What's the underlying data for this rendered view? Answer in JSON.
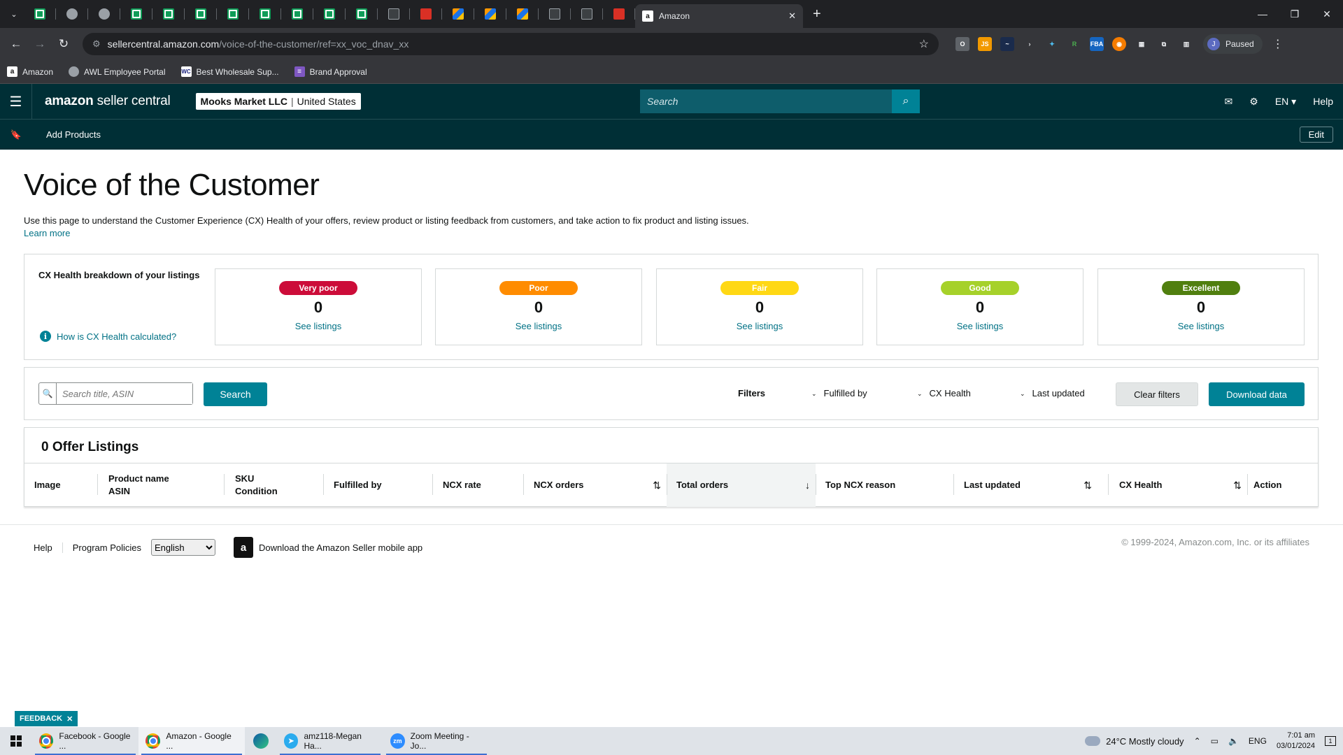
{
  "browser": {
    "active_tab_title": "Amazon",
    "url_domain": "sellercentral.amazon.com",
    "url_path": "/voice-of-the-customer/ref=xx_voc_dnav_xx",
    "profile_label": "Paused",
    "profile_initial": "J",
    "bookmarks": [
      {
        "label": "Amazon"
      },
      {
        "label": "AWL Employee Portal"
      },
      {
        "label": "Best Wholesale Sup..."
      },
      {
        "label": "Brand Approval"
      }
    ]
  },
  "header": {
    "logo_text": "amazon",
    "logo_suffix": " seller central",
    "business_name": "Mooks Market LLC",
    "marketplace": "United States",
    "search_placeholder": "Search",
    "language": "EN",
    "help": "Help"
  },
  "subnav": {
    "link": "Add Products",
    "edit": "Edit"
  },
  "page": {
    "title": "Voice of the Customer",
    "intro": "Use this page to understand the Customer Experience (CX) Health of your offers, review product or listing feedback from customers, and take action to fix product and listing issues.",
    "learn_more": "Learn more"
  },
  "cx_health": {
    "label": "CX Health breakdown of your listings",
    "help_link": "How is CX Health calculated?",
    "cards": [
      {
        "label": "Very poor",
        "count": "0",
        "link": "See listings",
        "color": "#cc0c39",
        "text_color": "#ffffff"
      },
      {
        "label": "Poor",
        "count": "0",
        "link": "See listings",
        "color": "#ff8c00",
        "text_color": "#ffffff"
      },
      {
        "label": "Fair",
        "count": "0",
        "link": "See listings",
        "color": "#ffd814",
        "text_color": "#ffffff"
      },
      {
        "label": "Good",
        "count": "0",
        "link": "See listings",
        "color": "#a6d12a",
        "text_color": "#ffffff"
      },
      {
        "label": "Excellent",
        "count": "0",
        "link": "See listings",
        "color": "#507f0f",
        "text_color": "#ffffff"
      }
    ]
  },
  "filters": {
    "search_placeholder": "Search title, ASIN",
    "search_button": "Search",
    "label": "Filters",
    "fulfilled_by": "Fulfilled by",
    "cx_health": "CX Health",
    "last_updated": "Last updated",
    "clear": "Clear filters",
    "download": "Download data"
  },
  "listings": {
    "title": "0 Offer Listings",
    "columns": {
      "image": "Image",
      "product_name": "Product name",
      "asin": "ASIN",
      "sku": "SKU",
      "condition": "Condition",
      "fulfilled_by": "Fulfilled by",
      "ncx_rate": "NCX rate",
      "ncx_orders": "NCX orders",
      "total_orders": "Total orders",
      "top_ncx_reason": "Top NCX reason",
      "last_updated": "Last updated",
      "cx_health": "CX Health",
      "action": "Action"
    }
  },
  "footer": {
    "help": "Help",
    "program_policies": "Program Policies",
    "language_selected": "English",
    "app_download": "Download the Amazon Seller mobile app",
    "copyright": "© 1999-2024, Amazon.com, Inc. or its affiliates",
    "feedback": "FEEDBACK"
  },
  "taskbar": {
    "apps": [
      {
        "label": "Facebook - Google ..."
      },
      {
        "label": "Amazon - Google ..."
      },
      {
        "label": "amz118-Megan Ha..."
      },
      {
        "label": "Zoom Meeting - Jo..."
      }
    ],
    "weather": "24°C  Mostly cloudy",
    "language": "ENG",
    "time": "7:01 am",
    "date": "03/01/2024"
  },
  "colors": {
    "header_bg": "#002f36",
    "accent": "#008296",
    "link": "#007185"
  }
}
